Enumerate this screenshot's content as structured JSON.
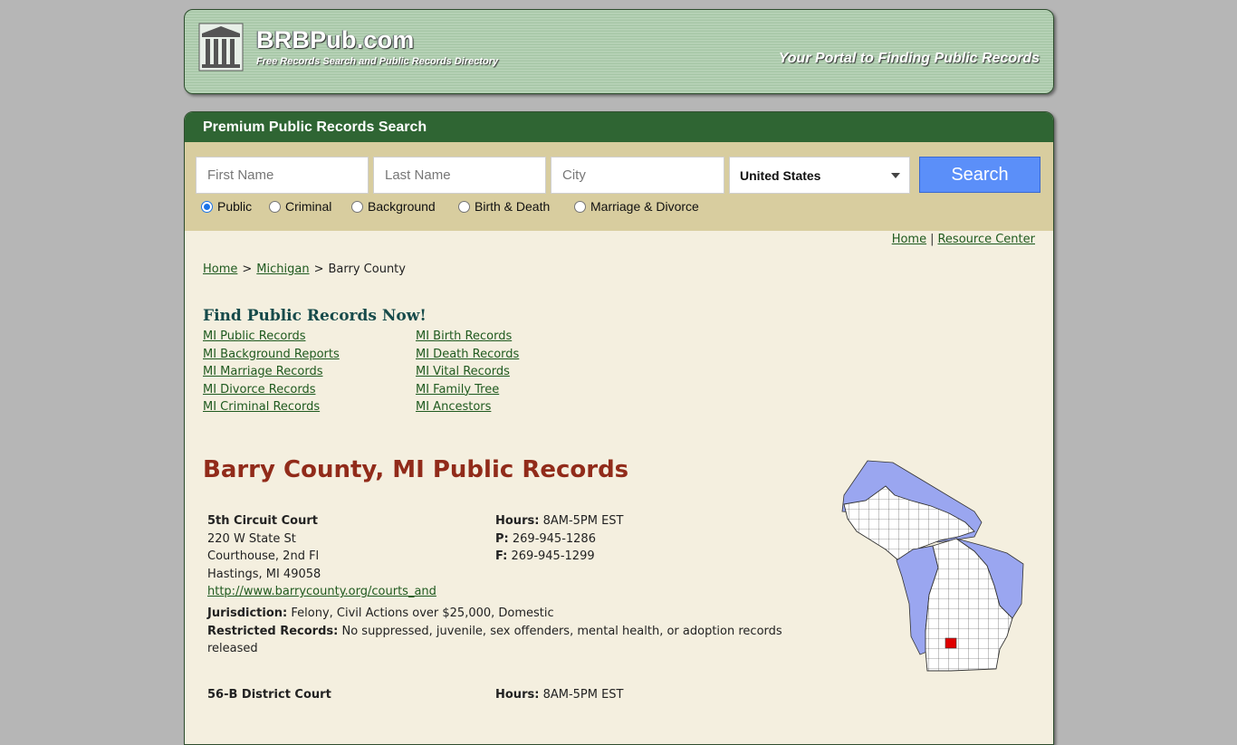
{
  "header": {
    "site_name": "BRBPub.com",
    "tagline": "Free Records Search and Public Records Directory",
    "slogan": "Your Portal to Finding Public Records"
  },
  "search": {
    "title": "Premium Public Records Search",
    "first_name_placeholder": "First Name",
    "last_name_placeholder": "Last Name",
    "city_placeholder": "City",
    "country_selected": "United States",
    "button_label": "Search",
    "record_types": [
      {
        "label": "Public",
        "checked": true
      },
      {
        "label": "Criminal",
        "checked": false
      },
      {
        "label": "Background",
        "checked": false
      },
      {
        "label": "Birth & Death",
        "checked": false
      },
      {
        "label": "Marriage & Divorce",
        "checked": false
      }
    ]
  },
  "top_links": {
    "home": "Home",
    "sep": "|",
    "resource_center": "Resource Center"
  },
  "breadcrumb": {
    "home": "Home",
    "state": "Michigan",
    "current": "Barry County",
    "sep": ">"
  },
  "find_records": {
    "heading": "Find Public Records Now!",
    "column_1": [
      "MI Public Records",
      "MI Background Reports",
      "MI Marriage Records",
      "MI Divorce Records",
      "MI Criminal Records"
    ],
    "column_2": [
      "MI Birth Records",
      "MI Death Records",
      "MI Vital Records",
      "MI Family Tree",
      "MI Ancestors"
    ]
  },
  "county": {
    "heading": "Barry County, MI Public Records",
    "offices": [
      {
        "name": "5th Circuit Court",
        "address_1": "220 W State St",
        "address_2": "Courthouse, 2nd Fl",
        "city_state_zip": "Hastings, MI 49058",
        "url": "http://www.barrycounty.org/courts_and",
        "hours_label": "Hours:",
        "hours": "8AM-5PM EST",
        "phone_label": "P:",
        "phone": "269-945-1286",
        "fax_label": "F:",
        "fax": "269-945-1299",
        "jurisdiction_label": "Jurisdiction:",
        "jurisdiction": "Felony, Civil Actions over $25,000, Domestic",
        "restricted_label": "Restricted Records:",
        "restricted": "No suppressed, juvenile, sex offenders, mental health, or adoption records released"
      },
      {
        "name": "56-B District Court",
        "hours_label": "Hours:",
        "hours": "8AM-5PM EST"
      }
    ]
  },
  "colors": {
    "search_bar": "#2f6533",
    "search_area": "#d8cd9f",
    "content_bg": "#f4efdf",
    "county_heading": "#912b1a",
    "search_button": "#5b8ff9",
    "map_water": "#9aa6f0",
    "map_highlight": "#e00000"
  }
}
